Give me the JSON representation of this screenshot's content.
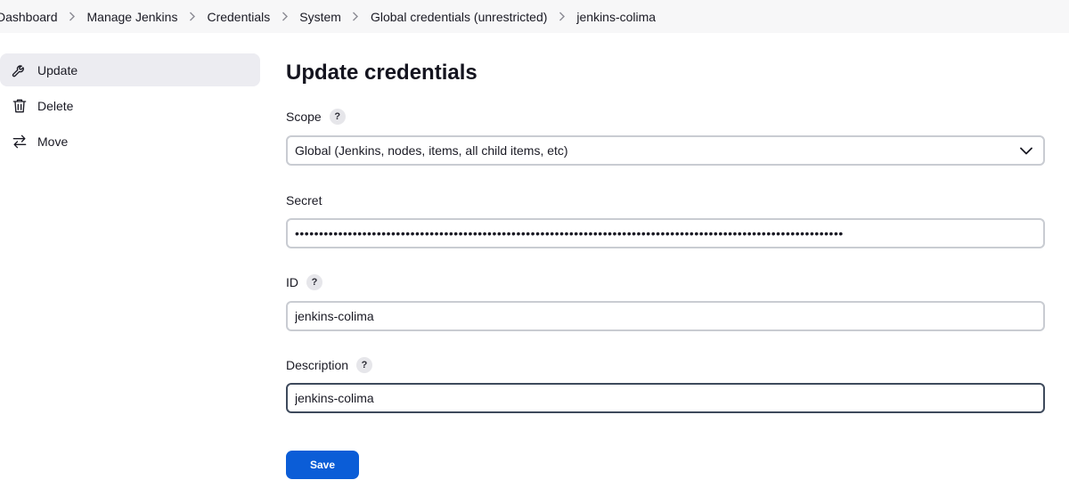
{
  "breadcrumb": [
    "Dashboard",
    "Manage Jenkins",
    "Credentials",
    "System",
    "Global credentials (unrestricted)",
    "jenkins-colima"
  ],
  "sidebar": {
    "items": [
      {
        "label": "Update",
        "icon": "wrench-icon"
      },
      {
        "label": "Delete",
        "icon": "trash-icon"
      },
      {
        "label": "Move",
        "icon": "arrows-swap-icon"
      }
    ]
  },
  "page": {
    "title": "Update credentials",
    "scope": {
      "label": "Scope",
      "value": "Global (Jenkins, nodes, items, all child items, etc)"
    },
    "secret": {
      "label": "Secret",
      "value": "••••••••••••••••••••••••••••••••••••••••••••••••••••••••••••••••••••••••••••••••••••••••••••••••••••••••••••••••••"
    },
    "id": {
      "label": "ID",
      "value": "jenkins-colima"
    },
    "description": {
      "label": "Description",
      "value": "jenkins-colima"
    },
    "save_label": "Save",
    "help_glyph": "?"
  },
  "colors": {
    "accent": "#0b5dd7",
    "active_bg": "#ececf1",
    "breadcrumb_bg": "#f7f7f8"
  }
}
